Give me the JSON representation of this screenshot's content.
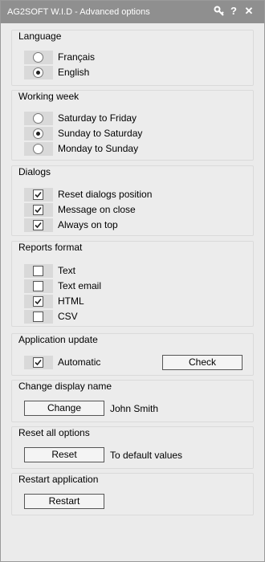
{
  "window": {
    "title": "AG2SOFT W.I.D - Advanced options",
    "icons": [
      "key-icon",
      "help-icon",
      "close-icon"
    ],
    "help_glyph": "?",
    "close_glyph": "✕"
  },
  "language": {
    "title": "Language",
    "options": [
      {
        "label": "Français",
        "selected": false
      },
      {
        "label": "English",
        "selected": true
      }
    ]
  },
  "working_week": {
    "title": "Working week",
    "options": [
      {
        "label": "Saturday to Friday",
        "selected": false
      },
      {
        "label": "Sunday to Saturday",
        "selected": true
      },
      {
        "label": "Monday to Sunday",
        "selected": false
      }
    ]
  },
  "dialogs": {
    "title": "Dialogs",
    "options": [
      {
        "label": "Reset dialogs position",
        "checked": true
      },
      {
        "label": "Message on close",
        "checked": true
      },
      {
        "label": "Always on top",
        "checked": true
      }
    ]
  },
  "reports_format": {
    "title": "Reports format",
    "options": [
      {
        "label": "Text",
        "checked": false
      },
      {
        "label": "Text email",
        "checked": false
      },
      {
        "label": "HTML",
        "checked": true
      },
      {
        "label": "CSV",
        "checked": false
      }
    ]
  },
  "application_update": {
    "title": "Application update",
    "automatic_label": "Automatic",
    "automatic_checked": true,
    "check_button": "Check"
  },
  "display_name": {
    "title": "Change display name",
    "button": "Change",
    "current_name": "John Smith"
  },
  "reset_options": {
    "title": "Reset all options",
    "button": "Reset",
    "description": "To default values"
  },
  "restart": {
    "title": "Restart application",
    "button": "Restart"
  }
}
